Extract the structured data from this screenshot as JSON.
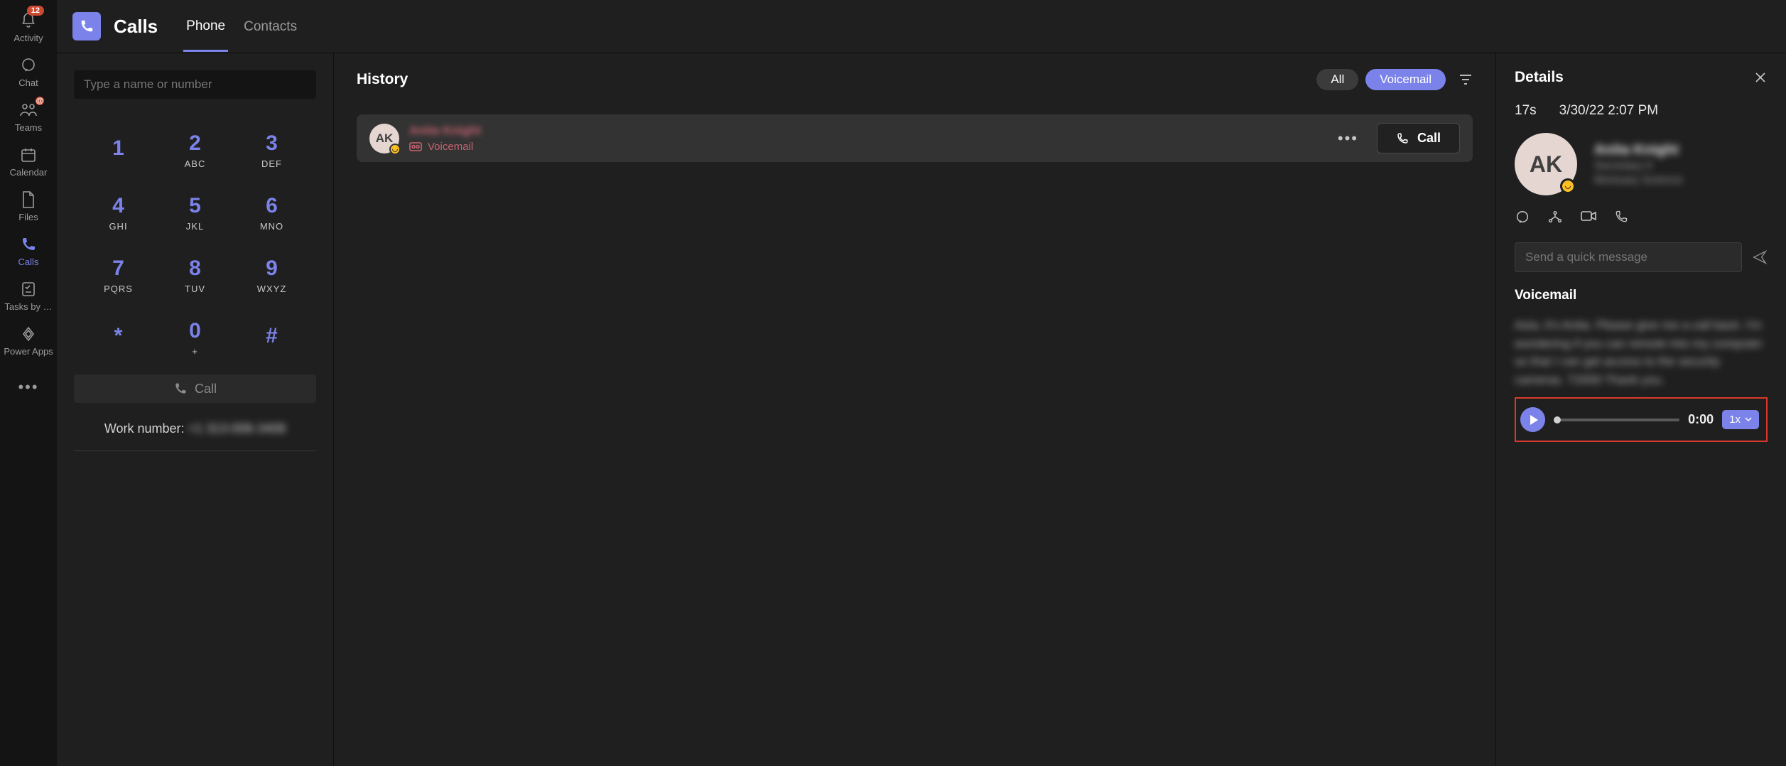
{
  "rail": {
    "items": [
      {
        "label": "Activity",
        "badge": "12"
      },
      {
        "label": "Chat"
      },
      {
        "label": "Teams",
        "badge": "@"
      },
      {
        "label": "Calendar"
      },
      {
        "label": "Files"
      },
      {
        "label": "Calls",
        "active": true
      },
      {
        "label": "Tasks by …"
      },
      {
        "label": "Power Apps"
      }
    ]
  },
  "header": {
    "title": "Calls",
    "tabs": [
      {
        "label": "Phone",
        "active": true
      },
      {
        "label": "Contacts"
      }
    ]
  },
  "dial": {
    "search_placeholder": "Type a name or number",
    "keys": [
      {
        "num": "1",
        "sub": ""
      },
      {
        "num": "2",
        "sub": "ABC"
      },
      {
        "num": "3",
        "sub": "DEF"
      },
      {
        "num": "4",
        "sub": "GHI"
      },
      {
        "num": "5",
        "sub": "JKL"
      },
      {
        "num": "6",
        "sub": "MNO"
      },
      {
        "num": "7",
        "sub": "PQRS"
      },
      {
        "num": "8",
        "sub": "TUV"
      },
      {
        "num": "9",
        "sub": "WXYZ"
      },
      {
        "num": "*",
        "sub": ""
      },
      {
        "num": "0",
        "sub": "+"
      },
      {
        "num": "#",
        "sub": ""
      }
    ],
    "call_label": "Call",
    "work_number_label": "Work number:",
    "work_number_value": "+1 313-006-3408"
  },
  "history": {
    "title": "History",
    "filters": {
      "all": "All",
      "voicemail": "Voicemail"
    },
    "rows": [
      {
        "initials": "AK",
        "name": "Anita Knight",
        "type_label": "Voicemail",
        "call_label": "Call"
      }
    ]
  },
  "details": {
    "title": "Details",
    "duration": "17s",
    "datetime": "3/30/22 2:07 PM",
    "initials": "AK",
    "name": "Anita Knight",
    "line2": "Secretary II",
    "line3": "Mortuary Science",
    "quick_placeholder": "Send a quick message",
    "voicemail_label": "Voicemail",
    "transcript": "Asia, it's Anita. Please give me a call back. I'm wondering if you can remote into my computer so that I can get access to the security cameras. T2000 Thank you.",
    "player": {
      "time": "0:00",
      "speed": "1x"
    }
  }
}
